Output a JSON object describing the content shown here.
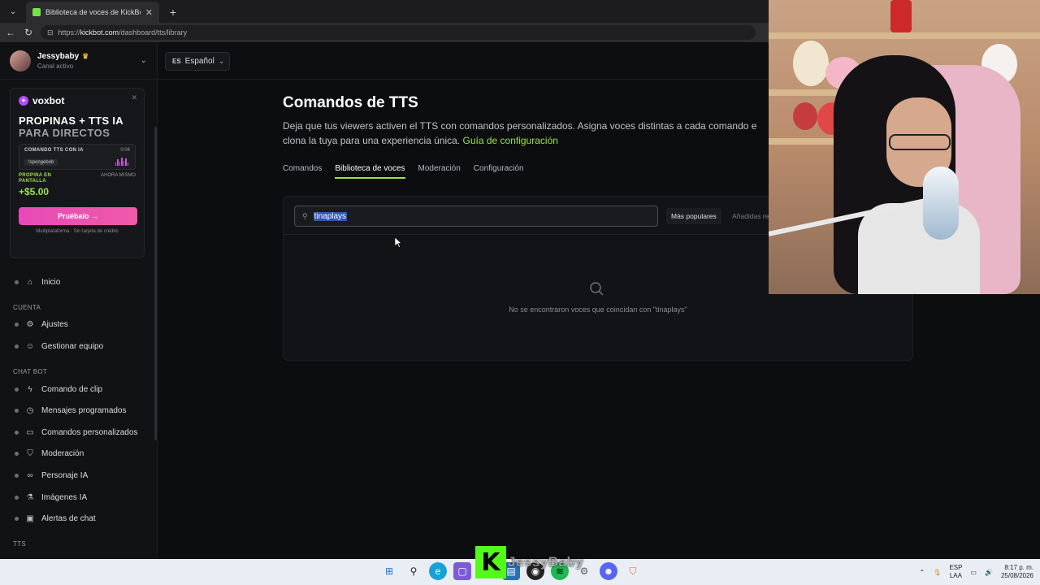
{
  "browser": {
    "tab_title": "Biblioteca de voces de KickBot",
    "url_prefix": "https://",
    "url_host": "kickbot.com",
    "url_path": "/dashboard/tts/library"
  },
  "profile": {
    "name": "Jessybaby",
    "status": "Canal activo"
  },
  "language": {
    "code": "ES",
    "label": "Español"
  },
  "promo": {
    "brand": "voxbot",
    "headline": "PROPINAS + TTS IA",
    "subheadline": "PARA DIRECTOS",
    "card_label": "COMANDO TTS CON IA",
    "card_time": "0:04",
    "card_chip": "!spongebob",
    "tip_label": "PROPINA EN PANTALLA",
    "tip_when": "AHORA MISMO",
    "tip_amount": "+$5.00",
    "cta": "Pruébalo →",
    "footnote": "Multiplataforma · Sin tarjeta de crédito"
  },
  "sidebar": {
    "home": "Inicio",
    "sections": [
      {
        "title": "CUENTA",
        "items": [
          "Ajustes",
          "Gestionar equipo"
        ]
      },
      {
        "title": "CHAT BOT",
        "items": [
          "Comando de clip",
          "Mensajes programados",
          "Comandos personalizados",
          "Moderación",
          "Personaje IA",
          "Imágenes IA",
          "Alertas de chat"
        ]
      },
      {
        "title": "TTS",
        "items": []
      }
    ]
  },
  "page": {
    "title": "Comandos de TTS",
    "description": "Deja que tus viewers activen el TTS con comandos personalizados. Asigna voces distintas a cada comando e",
    "description2": "clona la tuya para una experiencia única.",
    "guide_link": "Guía de configuración",
    "tabs": [
      "Comandos",
      "Biblioteca de voces",
      "Moderación",
      "Configuración"
    ],
    "active_tab": 1
  },
  "library": {
    "search_value": "tinaplays",
    "sort_popular": "Más populares",
    "sort_recent": "Añadidas re",
    "empty_message": "No se encontraron voces que coincidan con \"tinaplays\""
  },
  "overlay": {
    "channel_name": "JessyBaby"
  },
  "taskbar": {
    "lang_top": "ESP",
    "lang_bottom": "LAA",
    "time": "8:17 p. m.",
    "date": "25/08/2026"
  },
  "colors": {
    "accent": "#9de24b",
    "cta": "#e74ab8",
    "kick": "#53fc18"
  }
}
